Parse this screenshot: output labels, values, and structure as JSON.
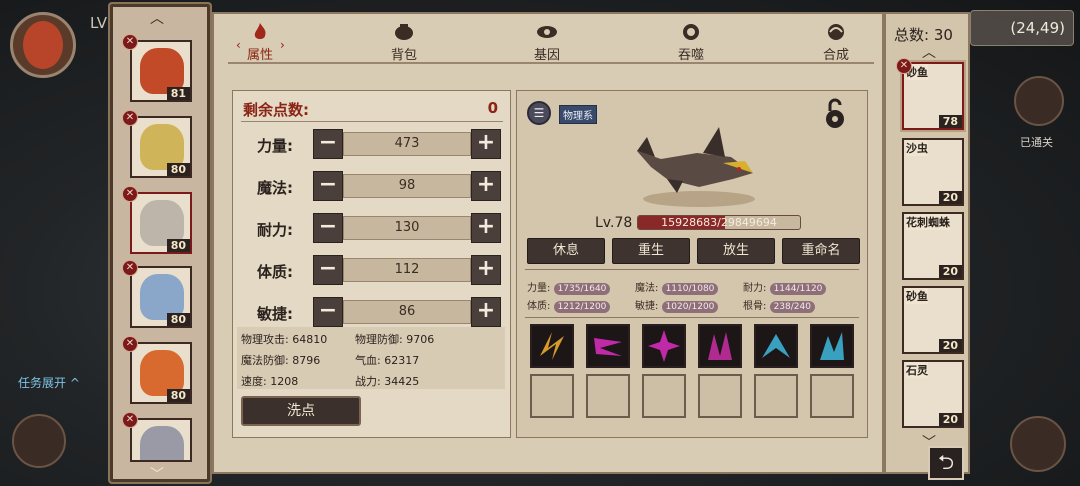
{
  "hud": {
    "level_tag": "LV",
    "coords": "(24,49)",
    "cleared_label": "已通关",
    "quest_toggle": "任务展开"
  },
  "tabs": [
    {
      "label": "属性",
      "active": true
    },
    {
      "label": "背包",
      "active": false
    },
    {
      "label": "基因",
      "active": false
    },
    {
      "label": "吞噬",
      "active": false
    },
    {
      "label": "合成",
      "active": false
    }
  ],
  "heroes": [
    {
      "level": "81"
    },
    {
      "level": "80"
    },
    {
      "level": "80"
    },
    {
      "level": "80"
    },
    {
      "level": "80"
    },
    {
      "level": ""
    }
  ],
  "attributes": {
    "remaining_label": "剩余点数:",
    "remaining_value": "0",
    "rows": [
      {
        "name": "力量:",
        "value": "473"
      },
      {
        "name": "魔法:",
        "value": "98"
      },
      {
        "name": "耐力:",
        "value": "130"
      },
      {
        "name": "体质:",
        "value": "112"
      },
      {
        "name": "敏捷:",
        "value": "86"
      }
    ],
    "stats": {
      "phys_atk": "物理攻击: 64810",
      "phys_def": "物理防御: 9706",
      "mag_def": "魔法防御: 8796",
      "qi_blood": "气血: 62317",
      "speed": "速度: 1208",
      "power": "战力: 34425"
    },
    "wash_button": "洗点"
  },
  "pet": {
    "type_label": "物理系",
    "level": "Lv.78",
    "hp_text": "15928683/29849694",
    "hp_fraction": 0.534,
    "actions": [
      "休息",
      "重生",
      "放生",
      "重命名"
    ],
    "aptitudes": [
      {
        "name": "力量:",
        "value": "1735/1640"
      },
      {
        "name": "魔法:",
        "value": "1110/1080"
      },
      {
        "name": "耐力:",
        "value": "1144/1120"
      },
      {
        "name": "体质:",
        "value": "1212/1200"
      },
      {
        "name": "敏捷:",
        "value": "1020/1200"
      },
      {
        "name": "根骨:",
        "value": "238/240"
      }
    ],
    "skill_colors": [
      "#d89a2a",
      "#c02aa8",
      "#c02aa8",
      "#b02a90",
      "#3aa0c0",
      "#3aa0c0"
    ]
  },
  "pets_list": {
    "total_label": "总数: 30",
    "items": [
      {
        "name": "砂鱼",
        "level": "78",
        "selected": true
      },
      {
        "name": "沙虫",
        "level": "20",
        "selected": false
      },
      {
        "name": "花刺蜘蛛",
        "level": "20",
        "selected": false
      },
      {
        "name": "砂鱼",
        "level": "20",
        "selected": false
      },
      {
        "name": "石灵",
        "level": "20",
        "selected": false
      }
    ]
  }
}
